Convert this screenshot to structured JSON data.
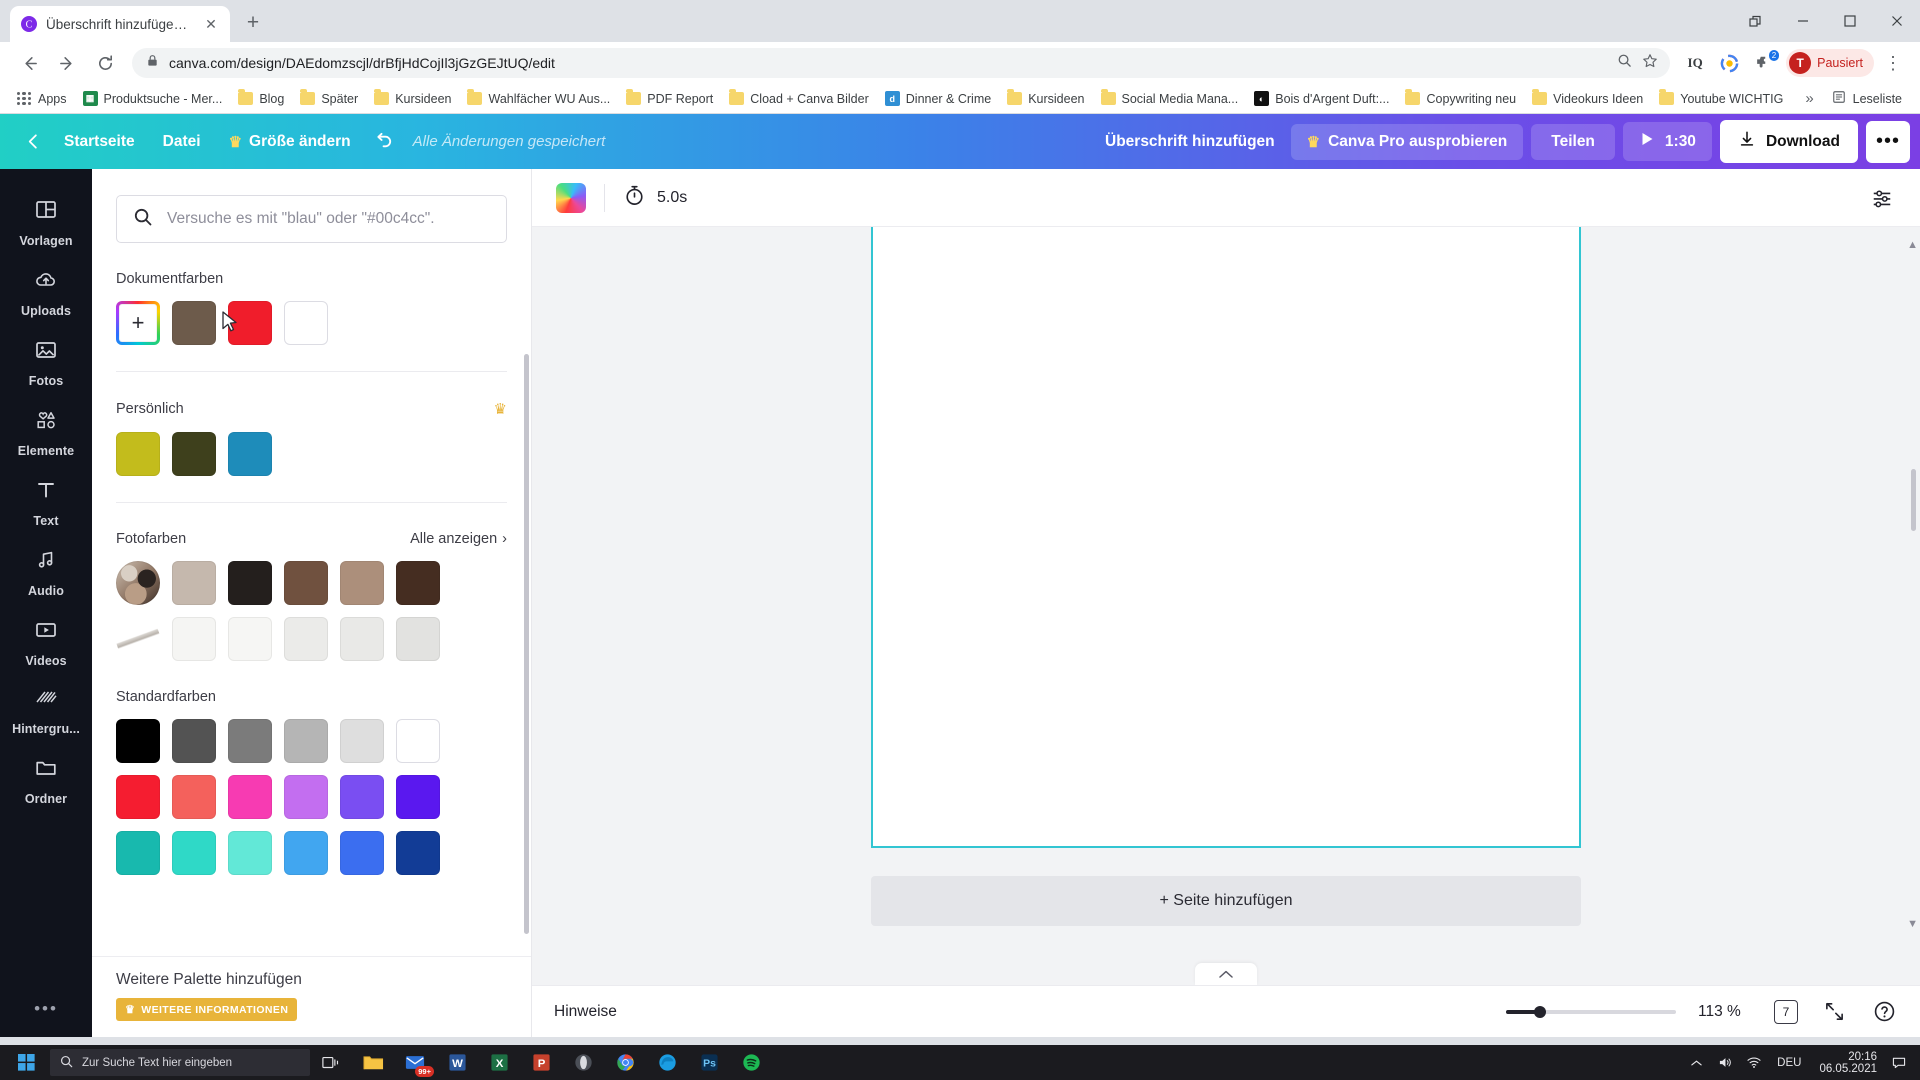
{
  "browser": {
    "tab": {
      "title": "Überschrift hinzufügen – Logo",
      "favicon_letter": "C",
      "close_label": "✕"
    },
    "new_tab_label": "+",
    "window_controls": {
      "minimize": "—",
      "maximize": "▢",
      "close": "✕",
      "restore": "⧉"
    },
    "nav": {
      "back": "←",
      "forward": "→",
      "reload": "⟳"
    },
    "omnibox": {
      "url": "canva.com/design/DAEdomzscjl/drBfjHdCojIl3jGzGEJtUQ/edit",
      "lock_icon": "lock-icon",
      "zoom_icon": "search-zoom-icon",
      "star_icon": "★"
    },
    "extensions": [
      {
        "name": "iq-extension",
        "label": "IQ"
      },
      {
        "name": "colorful-extension",
        "label": ""
      },
      {
        "name": "puzzle-extension",
        "label": "",
        "badge": "2"
      }
    ],
    "profile": {
      "initial": "T",
      "label": "Pausiert"
    },
    "menu_label": "⋮",
    "bookmarks": [
      {
        "label": "Apps",
        "icon": "apps-grid-icon"
      },
      {
        "label": "Produktsuche - Mer...",
        "icon": "site-icon",
        "color": "#1f8a4c"
      },
      {
        "label": "Blog",
        "icon": "folder-icon"
      },
      {
        "label": "Später",
        "icon": "folder-icon"
      },
      {
        "label": "Kursideen",
        "icon": "folder-icon"
      },
      {
        "label": "Wahlfächer WU Aus...",
        "icon": "folder-icon"
      },
      {
        "label": "PDF Report",
        "icon": "folder-icon"
      },
      {
        "label": "Cload + Canva Bilder",
        "icon": "folder-icon"
      },
      {
        "label": "Dinner & Crime",
        "icon": "site-icon",
        "color": "#2f8fd4",
        "letter": "d"
      },
      {
        "label": "Kursideen",
        "icon": "folder-icon"
      },
      {
        "label": "Social Media Mana...",
        "icon": "folder-icon"
      },
      {
        "label": "Bois d'Argent Duft:...",
        "icon": "site-icon",
        "color": "#111111",
        "letter": "◐"
      },
      {
        "label": "Copywriting neu",
        "icon": "folder-icon"
      },
      {
        "label": "Videokurs Ideen",
        "icon": "folder-icon"
      },
      {
        "label": "Youtube WICHTIG",
        "icon": "folder-icon"
      }
    ],
    "bookmarks_overflow": "»",
    "reading_list": {
      "label": "Leseliste",
      "icon": "reading-list-icon"
    }
  },
  "canva": {
    "topbar": {
      "back_icon": "chevron-left-icon",
      "home": "Startseite",
      "file": "Datei",
      "resize": "Größe ändern",
      "resize_crown": "♛",
      "undo_icon": "undo-arrow-icon",
      "saved_status": "Alle Änderungen gespeichert",
      "title": "Überschrift hinzufügen",
      "pro": "Canva Pro ausprobieren",
      "pro_crown": "♛",
      "share": "Teilen",
      "play_icon": "play-icon",
      "duration": "1:30",
      "download": "Download",
      "download_icon": "download-icon",
      "more": "•••"
    },
    "rail": [
      {
        "label": "Vorlagen",
        "icon": "templates-icon"
      },
      {
        "label": "Uploads",
        "icon": "upload-cloud-icon"
      },
      {
        "label": "Fotos",
        "icon": "photo-icon"
      },
      {
        "label": "Elemente",
        "icon": "shapes-icon"
      },
      {
        "label": "Text",
        "icon": "text-icon"
      },
      {
        "label": "Audio",
        "icon": "music-note-icon"
      },
      {
        "label": "Videos",
        "icon": "video-icon"
      },
      {
        "label": "Hintergru...",
        "icon": "background-pattern-icon"
      },
      {
        "label": "Ordner",
        "icon": "folder-icon"
      }
    ],
    "rail_more": "•••",
    "panel": {
      "search_placeholder": "Versuche es mit \"blau\" oder \"#00c4cc\".",
      "search_value": "",
      "search_icon": "search-icon",
      "sections": [
        {
          "title": "Dokumentfarben",
          "has_crown": false,
          "swatches": [
            "ADD",
            "#6d5b4b",
            "#f01d2b",
            "#ffffff"
          ]
        },
        {
          "title": "Persönlich",
          "has_crown": true,
          "crown": "♛",
          "swatches": [
            "#c3bc1c",
            "#3e401c",
            "#1e8cba"
          ]
        },
        {
          "title": "Fotofarben",
          "all_label": "Alle anzeigen",
          "all_chevron": "›",
          "has_crown": false,
          "swatches": [
            "PHOTO",
            "#c5b8ad",
            "#241f1d",
            "#70513f",
            "#ac8f7b",
            "#452d21",
            "PHOTO2",
            "#f5f5f3",
            "#f6f6f4",
            "#ebebe9",
            "#e9e9e7",
            "#e2e2e0"
          ]
        },
        {
          "title": "Standardfarben",
          "has_crown": false,
          "swatches": [
            "#000000",
            "#535353",
            "#7b7b7b",
            "#b5b5b5",
            "#dedede",
            "#ffffff",
            "#f51d30",
            "#f4615c",
            "#f73bb2",
            "#c36ef0",
            "#7a4ef2",
            "#5a18ef",
            "#18b9ae",
            "#2fd9c7",
            "#62e8d7",
            "#41a6f0",
            "#3b6ef0",
            "#123c96"
          ]
        }
      ],
      "bottom": {
        "title": "Weitere Palette hinzufügen",
        "button_label": "WEITERE INFORMATIONEN",
        "button_crown": "♛"
      }
    },
    "editor": {
      "color_chip": "rainbow-color-chip",
      "timer_icon": "stopwatch-icon",
      "timer_value": "5.0s",
      "layout_icon": "panel-layout-icon",
      "add_page": "+ Seite hinzufügen",
      "collapse_icon": "chevron-up-icon",
      "scroll_up": "▲",
      "scroll_down": "▼"
    },
    "statusbar": {
      "notes": "Hinweise",
      "zoom": "113 %",
      "page_count": "7",
      "fullscreen_icon": "expand-icon",
      "help_icon": "help-circle-icon",
      "minus": "−",
      "plus": "+"
    }
  },
  "taskbar": {
    "start_icon": "windows-start-icon",
    "search_placeholder": "Zur Suche Text hier eingeben",
    "search_icon": "search-icon",
    "items": [
      {
        "name": "task-view",
        "icon": "task-view-icon"
      },
      {
        "name": "file-explorer",
        "icon": "folder-icon"
      },
      {
        "name": "mail",
        "icon": "mail-icon",
        "badge": "99+"
      },
      {
        "name": "word",
        "icon": "word-icon",
        "label": "W"
      },
      {
        "name": "excel",
        "icon": "excel-icon",
        "label": "X"
      },
      {
        "name": "powerpoint",
        "icon": "powerpoint-icon",
        "label": "P"
      },
      {
        "name": "opera",
        "icon": "opera-icon"
      },
      {
        "name": "chrome",
        "icon": "chrome-icon"
      },
      {
        "name": "edge",
        "icon": "edge-icon"
      },
      {
        "name": "photoshop",
        "icon": "photoshop-icon"
      },
      {
        "name": "spotify",
        "icon": "spotify-icon"
      }
    ],
    "tray": {
      "expand": "︿",
      "volume_icon": "speaker-icon",
      "network_icon": "network-icon",
      "language": "DEU",
      "time": "20:16",
      "date": "06.05.2021",
      "notification_icon": "notification-icon"
    }
  }
}
